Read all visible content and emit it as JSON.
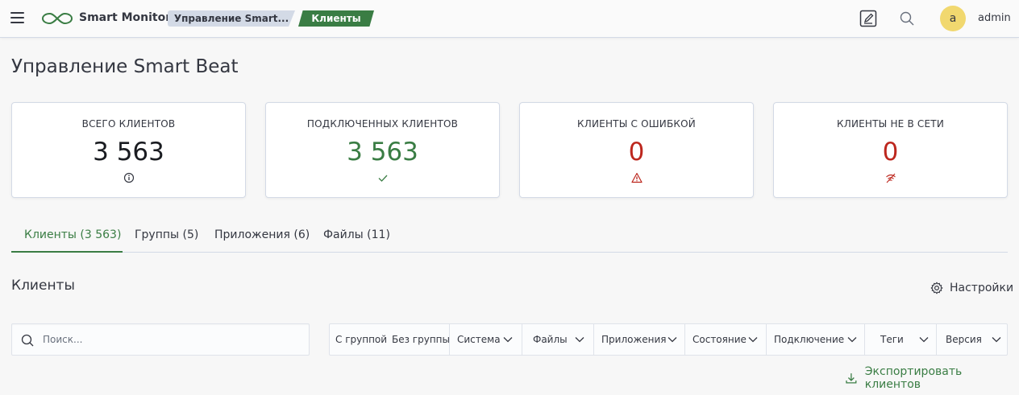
{
  "header": {
    "app_title": "Smart Monitor",
    "breadcrumbs": [
      "Управление Smart...",
      "Клиенты"
    ],
    "user": {
      "avatar_letter": "a",
      "name": "admin"
    }
  },
  "page": {
    "title": "Управление Smart Beat"
  },
  "stats": [
    {
      "label": "ВСЕГО КЛИЕНТОВ",
      "value": "3 563",
      "icon": "info-icon",
      "color": "#1a1c21"
    },
    {
      "label": "ПОДКЛЮЧЕННЫХ КЛИЕНТОВ",
      "value": "3 563",
      "icon": "check-icon",
      "color": "#3a7d44"
    },
    {
      "label": "КЛИЕНТЫ С ОШИБКОЙ",
      "value": "0",
      "icon": "warning-icon",
      "color": "#bd271e"
    },
    {
      "label": "КЛИЕНТЫ НЕ В СЕТИ",
      "value": "0",
      "icon": "offline-icon",
      "color": "#bd271e"
    }
  ],
  "tabs": [
    {
      "label": "Клиенты (3 563)",
      "active": true
    },
    {
      "label": "Группы (5)",
      "active": false
    },
    {
      "label": "Приложения (6)",
      "active": false
    },
    {
      "label": "Файлы (11)",
      "active": false
    }
  ],
  "section": {
    "title": "Клиенты",
    "settings_label": "Настройки",
    "search_placeholder": "Поиск...",
    "filters": {
      "with_group": "С группой",
      "without_group": "Без группы",
      "dropdowns": [
        "Система",
        "Файлы",
        "Приложения",
        "Состояние",
        "Подключение",
        "Теги",
        "Версия"
      ]
    },
    "export_label": "Экспортировать клиентов"
  },
  "colors": {
    "accent": "#3a7d44",
    "danger": "#bd271e",
    "avatar": "#f1d86f"
  }
}
